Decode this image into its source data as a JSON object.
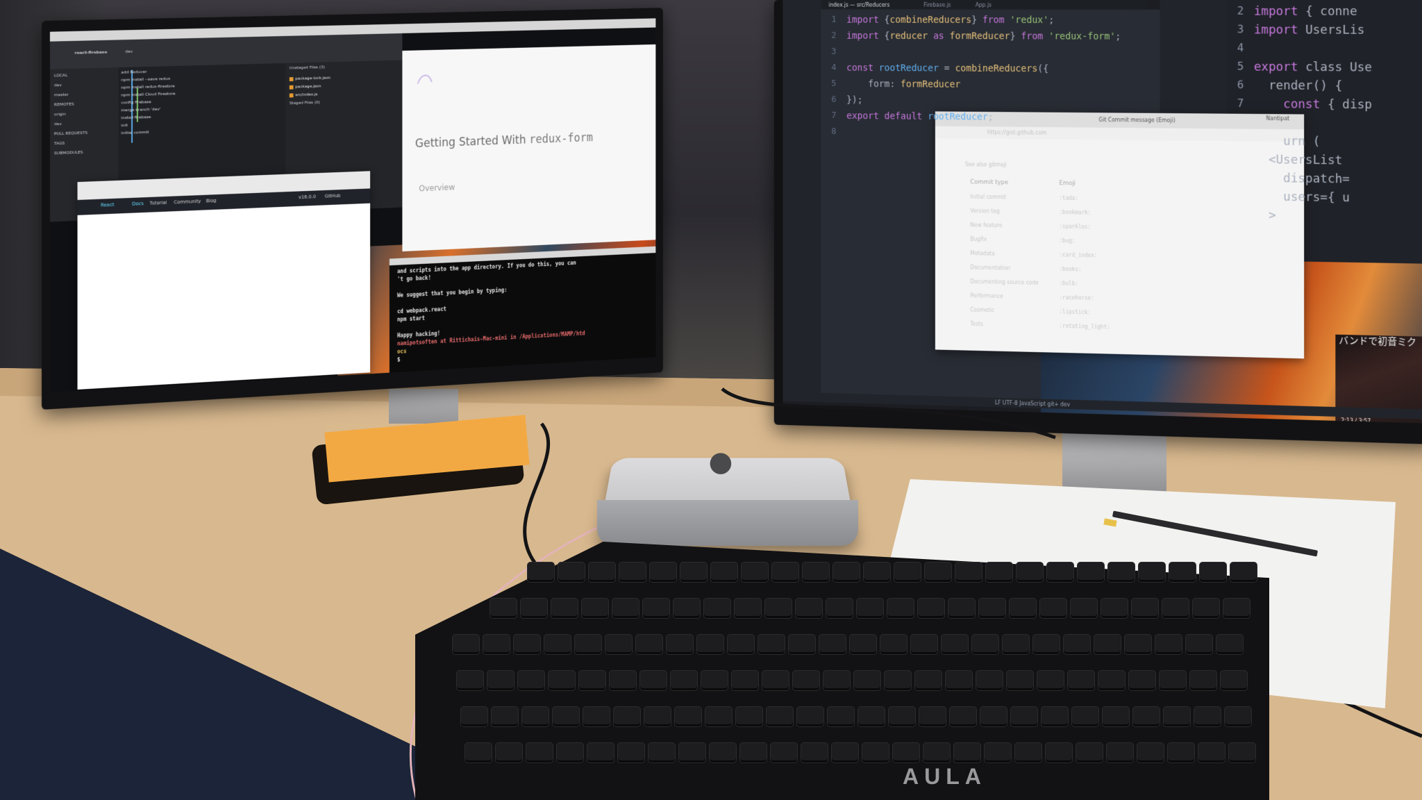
{
  "scene": {
    "left_monitor": {
      "sourcetree": {
        "repo": "react-firebase",
        "branch": "dev",
        "sidebar_items": [
          "LOCAL",
          "dev",
          "master",
          "REMOTES",
          "origin",
          "dev",
          "PULL REQUESTS",
          "TAGS",
          "SUBMODULES"
        ],
        "commits": [
          "add Reducer",
          "npm install --save redux",
          "npm install redux-firestore",
          "npm install Cloud Firestore",
          "config firebase",
          "merge branch 'dev'",
          "install firebase",
          "init",
          "initial commit"
        ],
        "staged_header": "Unstaged Files (3)",
        "files": [
          "package-lock.json",
          "package.json",
          "src/index.js"
        ],
        "staged_files_header": "Staged Files (0)"
      },
      "docs": {
        "title_prefix": "Getting Started With",
        "title_code": "redux-form",
        "overview": "Overview"
      },
      "react_site": {
        "logo": "React",
        "nav": [
          "Docs",
          "Tutorial",
          "Community",
          "Blog"
        ],
        "version": "v16.0.0",
        "github": "GitHub"
      },
      "terminal": {
        "lines": [
          "and scripts into the app directory. If you do this, you can",
          "'t go back!",
          "",
          "We suggest that you begin by typing:",
          "",
          "cd webpack.react",
          "npm start",
          "",
          "Happy hacking!",
          "namipotsoften at Rittichais-Mac-mini in /Applications/MAMP/htd",
          "ocs",
          "$"
        ]
      }
    },
    "right_monitor": {
      "editor_tabs": [
        "index.js — src/Reducers",
        "Firebase.js",
        "App.js"
      ],
      "editor_lines": [
        {
          "n": "1",
          "code": "import {combineReducers} from 'redux';"
        },
        {
          "n": "2",
          "code": "import {reducer as formReducer} from 'redux-form';"
        },
        {
          "n": "3",
          "code": ""
        },
        {
          "n": "4",
          "code": "const rootReducer = combineReducers({"
        },
        {
          "n": "5",
          "code": "    form: formReducer"
        },
        {
          "n": "6",
          "code": "});"
        },
        {
          "n": "7",
          "code": "export default rootReducer;"
        },
        {
          "n": "8",
          "code": ""
        }
      ],
      "second_pane_lines": [
        {
          "n": "2",
          "code": "import { conne"
        },
        {
          "n": "3",
          "code": "import UsersLis"
        },
        {
          "n": "4",
          "code": ""
        },
        {
          "n": "5",
          "code": "export class Use"
        },
        {
          "n": "6",
          "code": "  render() {"
        },
        {
          "n": "7",
          "code": "    const { disp"
        },
        {
          "n": "",
          "code": ""
        },
        {
          "n": "",
          "code": "    urn ("
        },
        {
          "n": "",
          "code": "  <UsersList"
        },
        {
          "n": "",
          "code": "    dispatch="
        },
        {
          "n": "",
          "code": "    users={ u"
        },
        {
          "n": "",
          "code": "  >"
        }
      ],
      "gist": {
        "tabs": [
          "Git Commit message (Emoji)",
          "Nantipat"
        ],
        "url": "https://gist.github.com",
        "see_also": "See also gitmoji",
        "col_type": "Commit type",
        "col_emoji": "Emoji",
        "rows": [
          {
            "type": "Initial commit",
            "emoji": ":tada:"
          },
          {
            "type": "Version tag",
            "emoji": ":bookmark:"
          },
          {
            "type": "New feature",
            "emoji": ":sparkles:"
          },
          {
            "type": "Bugfix",
            "emoji": ":bug:"
          },
          {
            "type": "Metadata",
            "emoji": ":card_index:"
          },
          {
            "type": "Documentation",
            "emoji": ":books:"
          },
          {
            "type": "Documenting source code",
            "emoji": ":bulb:"
          },
          {
            "type": "Performance",
            "emoji": ":racehorse:"
          },
          {
            "type": "Cosmetic",
            "emoji": ":lipstick:"
          },
          {
            "type": "Tests",
            "emoji": ":rotating_light:"
          }
        ]
      },
      "status_bar": "LF  UTF-8  JavaScript  git+  dev",
      "youtube_title": "バンドで初音ミク",
      "youtube_time": "2:13 / 3:57"
    },
    "keyboard_brand": "AULA"
  }
}
